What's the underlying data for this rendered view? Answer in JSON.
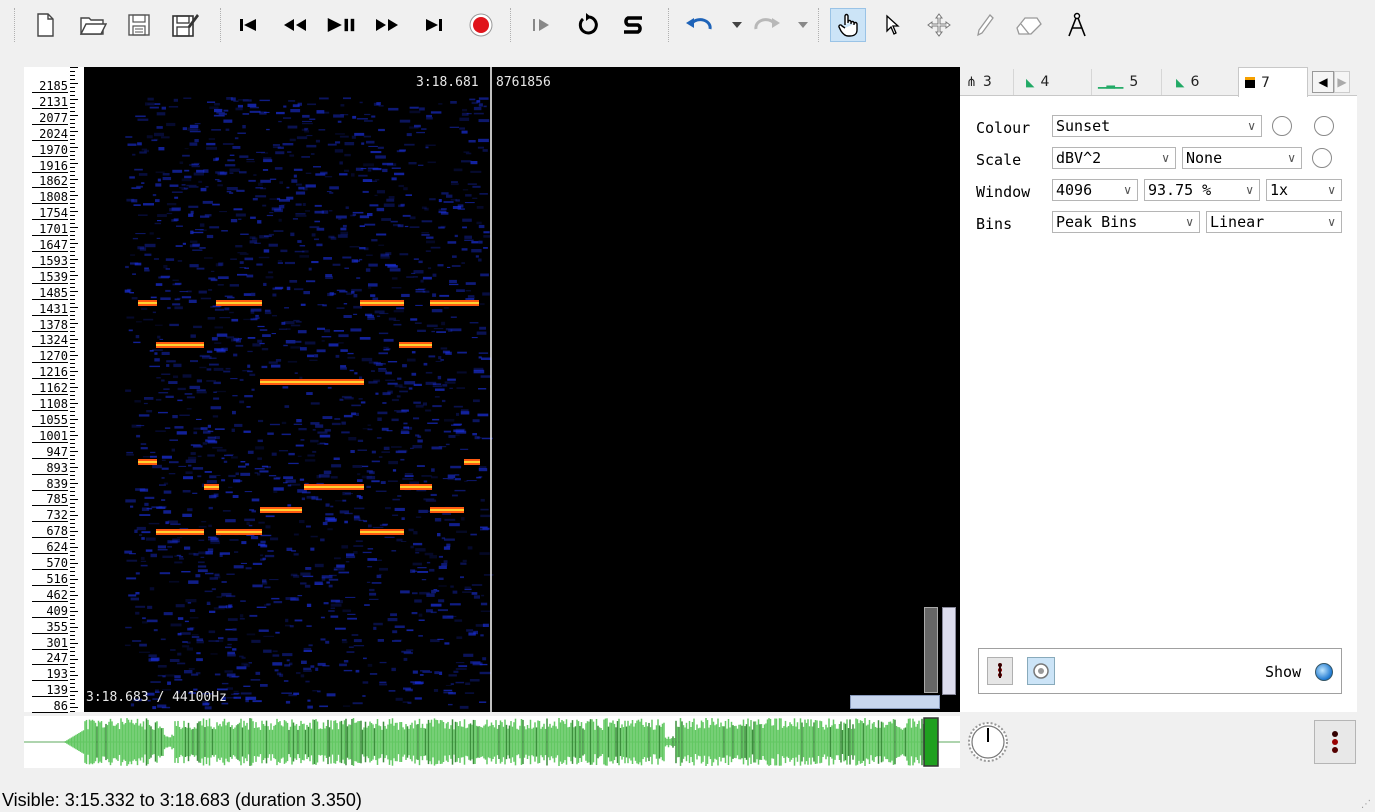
{
  "toolbar": {
    "file": [
      "new-file-icon",
      "open-folder-icon",
      "save-icon",
      "save-as-icon"
    ],
    "transport": [
      "rewind-start-icon",
      "rewind-icon",
      "play-pause-icon",
      "fast-forward-icon",
      "forward-end-icon",
      "record-icon"
    ],
    "playback": [
      "play-selection-icon",
      "loop-icon",
      "solo-icon"
    ],
    "edit": [
      "undo-icon",
      "redo-icon"
    ],
    "tools": [
      "navigate-hand-icon",
      "select-arrow-icon",
      "move-cross-icon",
      "draw-pencil-icon",
      "erase-icon",
      "measure-compass-icon"
    ],
    "colors": {
      "record": "#e0141b",
      "accent": "#1e63b8",
      "tool_active_bg": "#cce4f7"
    }
  },
  "spectrogram": {
    "top_readout_time": "3:18.681",
    "top_readout_frame": "8761856",
    "bottom_readout": "3:18.683 / 44100Hz",
    "scale_ticks": [
      "2185",
      "2131",
      "2077",
      "2024",
      "1970",
      "1916",
      "1862",
      "1808",
      "1754",
      "1701",
      "1647",
      "1593",
      "1539",
      "1485",
      "1431",
      "1378",
      "1324",
      "1270",
      "1216",
      "1162",
      "1108",
      "1055",
      "1001",
      "947",
      "893",
      "839",
      "785",
      "732",
      "678",
      "624",
      "570",
      "516",
      "462",
      "409",
      "355",
      "301",
      "247",
      "193",
      "139",
      "86"
    ],
    "colors": {
      "background": "#000000",
      "noise": "#1a2fd8",
      "peak": "#ff5a10",
      "peak_core": "#ffd030",
      "playhead": "#ffffff"
    }
  },
  "sidebar": {
    "tabs": [
      {
        "label": "3",
        "icon": "waveform-tab-icon"
      },
      {
        "label": "4",
        "icon": "spectrum-tab-icon"
      },
      {
        "label": "5",
        "icon": "bars-tab-icon"
      },
      {
        "label": "6",
        "icon": "spectrum-tab-icon"
      },
      {
        "label": "7",
        "icon": "spectrogram-tab-icon",
        "active": true
      }
    ],
    "colour": {
      "label": "Colour",
      "value": "Sunset"
    },
    "scale": {
      "label": "Scale",
      "value": "dBV^2",
      "value2": "None"
    },
    "window": {
      "label": "Window",
      "size": "4096",
      "overlap": "93.75 %",
      "oversample": "1x"
    },
    "bins": {
      "label": "Bins",
      "mode": "Peak Bins",
      "scale": "Linear"
    },
    "show_label": "Show"
  },
  "status": {
    "text": "Visible: 3:15.332 to 3:18.683 (duration 3.350)"
  }
}
